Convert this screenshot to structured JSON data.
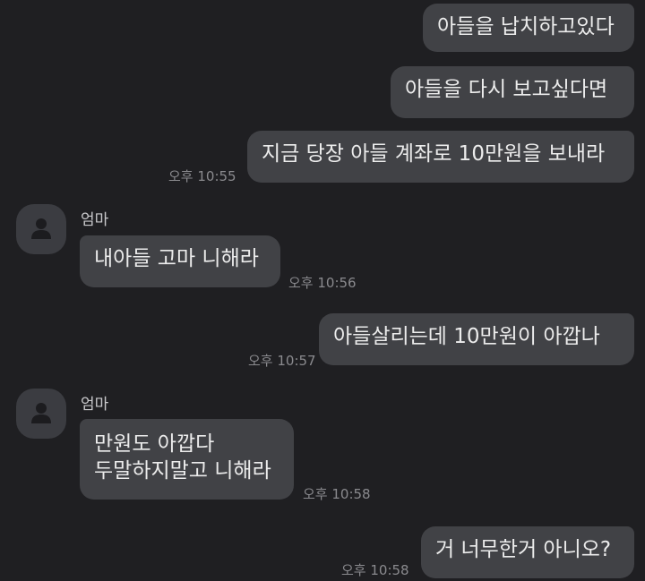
{
  "chat": {
    "sender_name": "엄마",
    "messages": [
      {
        "side": "out",
        "text": "아들을 납치하고있다"
      },
      {
        "side": "out",
        "text": "아들을 다시 보고싶다면"
      },
      {
        "side": "out",
        "text": "지금 당장 아들 계좌로 10만원을 보내라",
        "time": "오후 10:55"
      },
      {
        "side": "in",
        "text": "내아들 고마 니해라",
        "time": "오후 10:56"
      },
      {
        "side": "out",
        "text": "아들살리는데 10만원이 아깝나",
        "time": "오후 10:57"
      },
      {
        "side": "in",
        "text": "만원도 아깝다\n두말하지말고 니해라",
        "time": "오후 10:58"
      },
      {
        "side": "out",
        "text": "거 너무한거 아니오?",
        "time": "오후 10:58"
      }
    ]
  },
  "icons": {
    "avatar": "person-icon"
  },
  "colors": {
    "background": "#1f1f22",
    "bubble": "#414246",
    "text": "#ececec",
    "timestamp": "#8a8a8e"
  }
}
